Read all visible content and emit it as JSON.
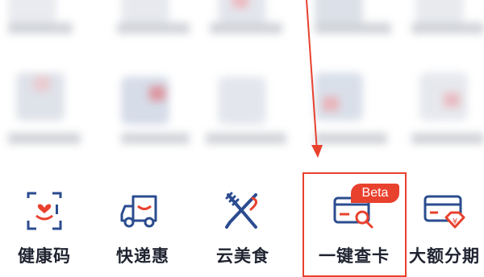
{
  "apps": [
    {
      "label": "健康码",
      "icon": "health-code-icon"
    },
    {
      "label": "快递惠",
      "icon": "delivery-truck-icon"
    },
    {
      "label": "云美食",
      "icon": "fork-knife-icon"
    },
    {
      "label": "一键查卡",
      "icon": "card-search-icon",
      "badge": "Beta"
    },
    {
      "label": "大额分期",
      "icon": "installment-card-icon"
    }
  ],
  "colors": {
    "accent_red": "#e8412e",
    "icon_blue": "#2b4c8f",
    "label_dark": "#1f2330"
  }
}
